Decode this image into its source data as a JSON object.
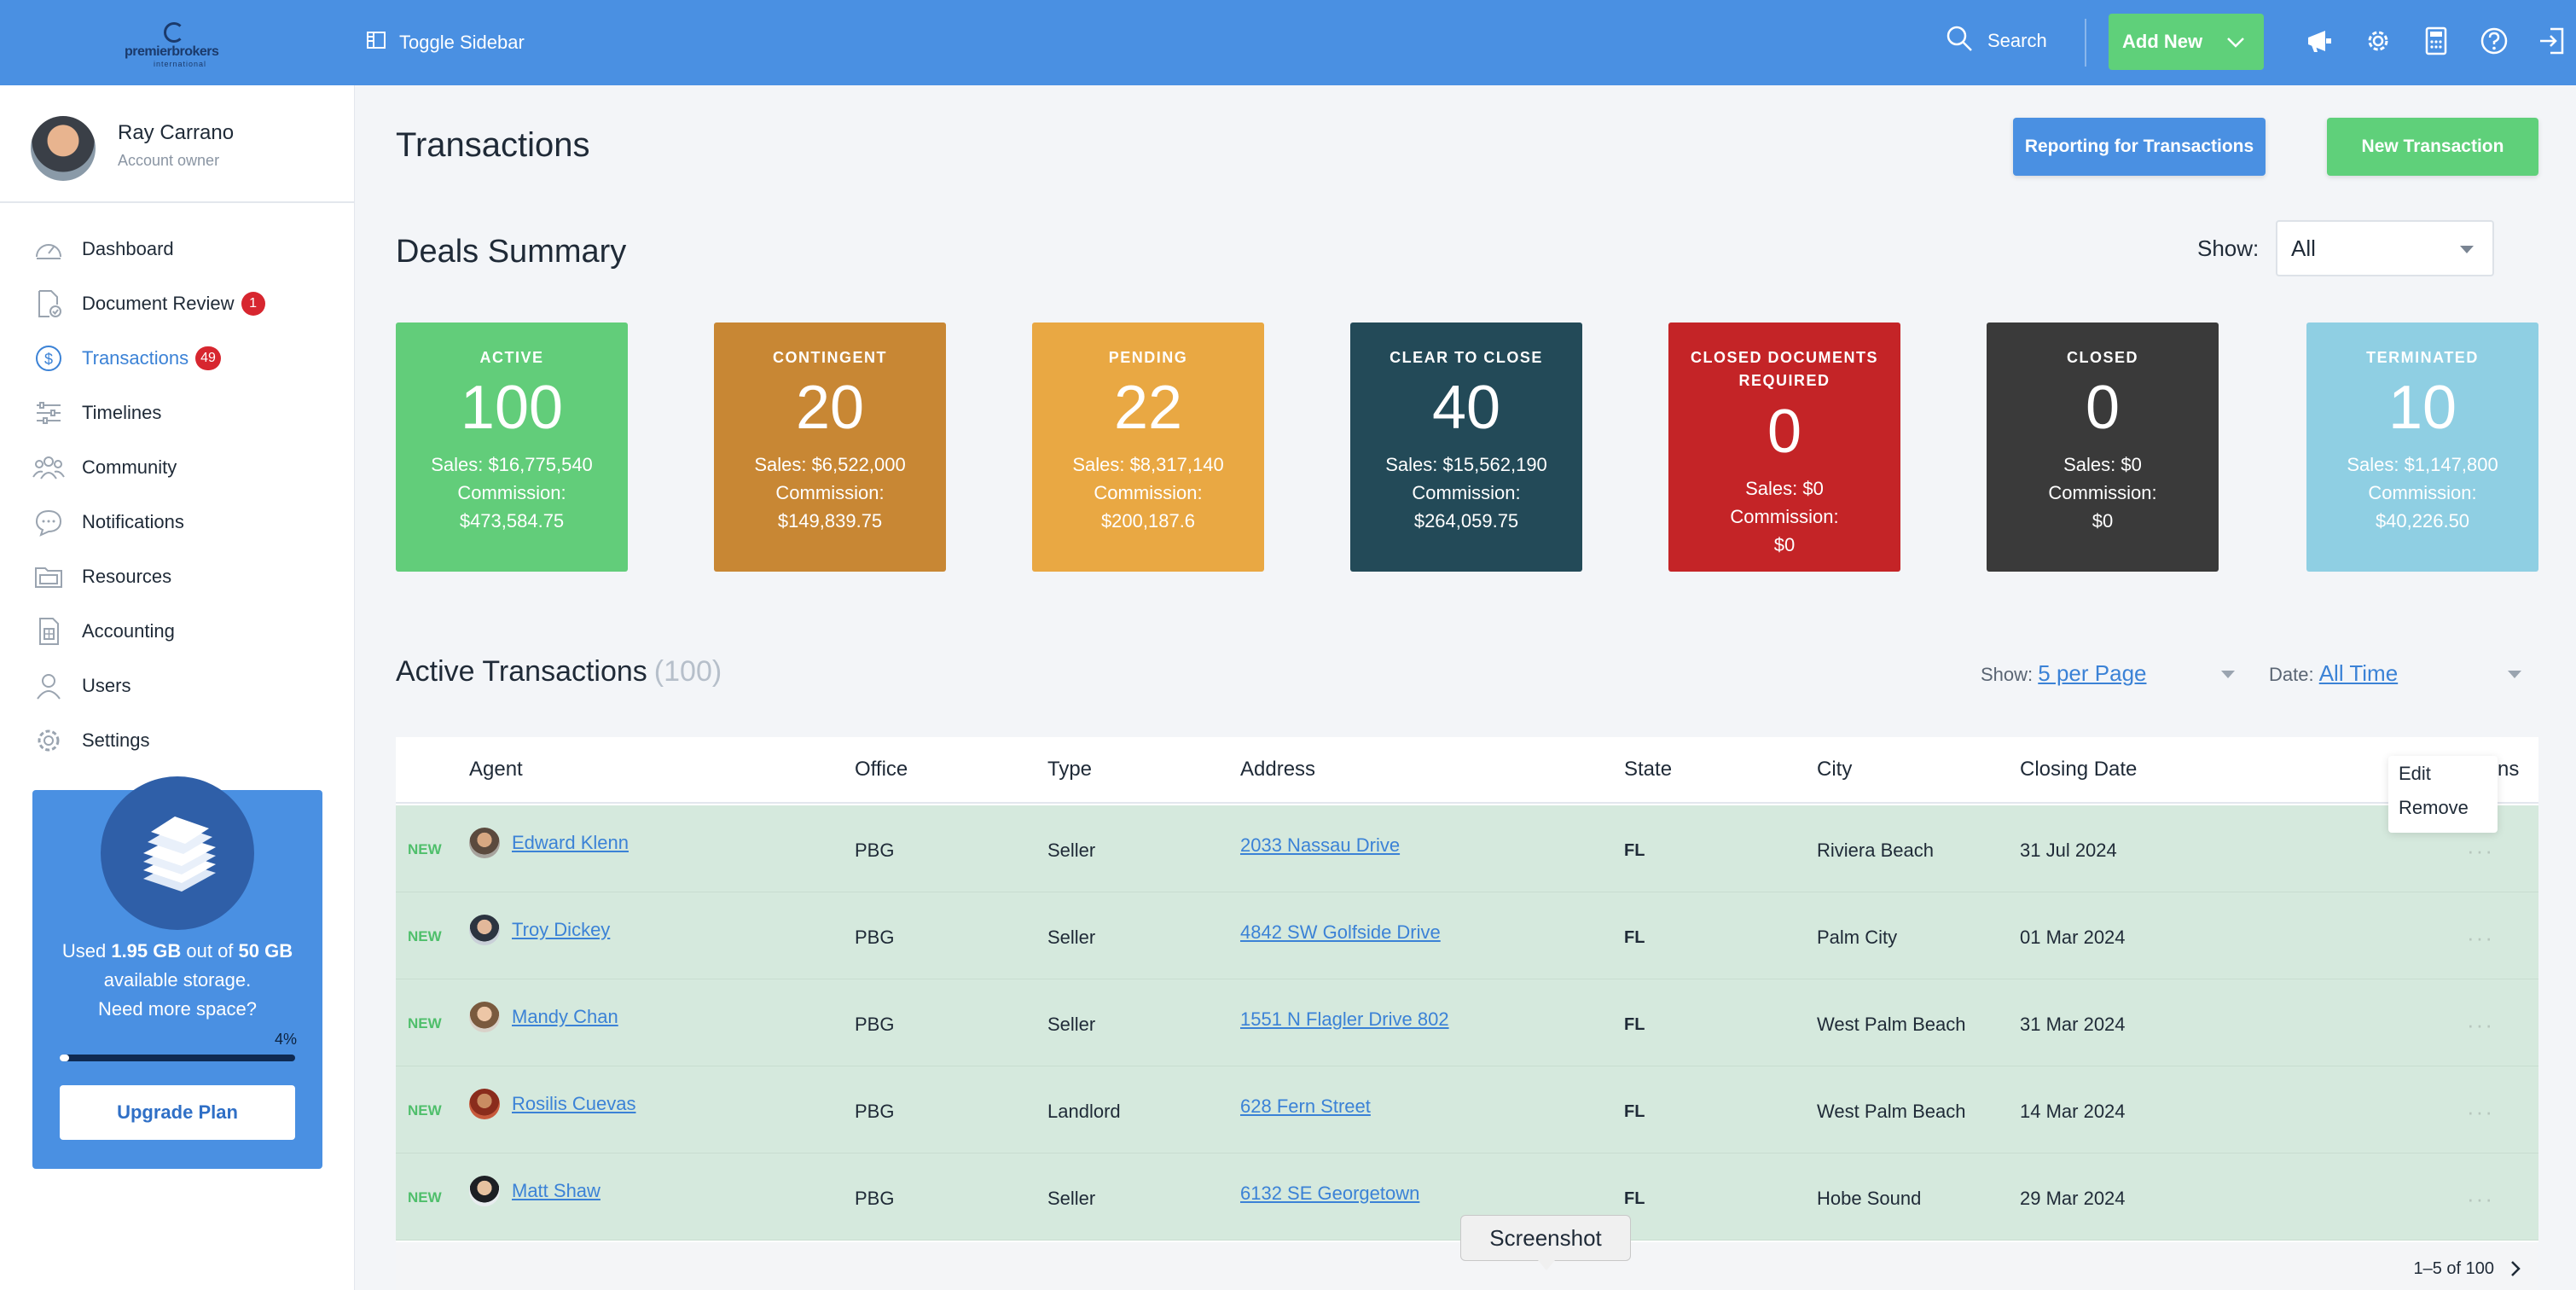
{
  "colors": {
    "topbar": "#4a90e2",
    "active": "#62cd7a",
    "contingent": "#c88734",
    "pending": "#e9a843",
    "clear_to_close": "#234a58",
    "closed_docs": "#c42427",
    "closed": "#3a3a3a",
    "terminated": "#8fcfe3",
    "new_row_bg": "#d5e9dd",
    "link": "#3b82d6"
  },
  "topbar": {
    "logo_text": "premierbrokers",
    "logo_sub": "international",
    "toggle_label": "Toggle Sidebar",
    "search_label": "Search",
    "add_new_label": "Add New",
    "icons": [
      "megaphone-icon",
      "gear-icon",
      "calculator-icon",
      "help-icon",
      "logout-icon"
    ]
  },
  "profile": {
    "name": "Ray Carrano",
    "role": "Account owner"
  },
  "sidebar": {
    "items": [
      {
        "label": "Dashboard",
        "icon": "dashboard-icon",
        "badge": ""
      },
      {
        "label": "Document Review",
        "icon": "document-check-icon",
        "badge": "1"
      },
      {
        "label": "Transactions",
        "icon": "dollar-icon",
        "badge": "49"
      },
      {
        "label": "Timelines",
        "icon": "sliders-icon",
        "badge": ""
      },
      {
        "label": "Community",
        "icon": "people-icon",
        "badge": ""
      },
      {
        "label": "Notifications",
        "icon": "chat-icon",
        "badge": ""
      },
      {
        "label": "Resources",
        "icon": "folder-icon",
        "badge": ""
      },
      {
        "label": "Accounting",
        "icon": "calculator-icon",
        "badge": ""
      },
      {
        "label": "Users",
        "icon": "user-icon",
        "badge": ""
      },
      {
        "label": "Settings",
        "icon": "gear-icon",
        "badge": ""
      }
    ]
  },
  "storage": {
    "used_prefix": "Used ",
    "used": "1.95 GB",
    "mid": " out of ",
    "total": "50 GB",
    "suffix": " available storage.",
    "more": "Need more space?",
    "percent_label": "4%",
    "percent": 4,
    "upgrade_label": "Upgrade Plan"
  },
  "page": {
    "title": "Transactions",
    "reporting_label": "Reporting for Transactions",
    "new_transaction_label": "New Transaction"
  },
  "deals": {
    "title": "Deals Summary",
    "show_label": "Show:",
    "show_value": "All",
    "cards": [
      {
        "label": "ACTIVE",
        "count": "100",
        "sales": "Sales: $16,775,540",
        "commission_label": "Commission:",
        "commission": "$473,584.75"
      },
      {
        "label": "CONTINGENT",
        "count": "20",
        "sales": "Sales: $6,522,000",
        "commission_label": "Commission:",
        "commission": "$149,839.75"
      },
      {
        "label": "PENDING",
        "count": "22",
        "sales": "Sales: $8,317,140",
        "commission_label": "Commission:",
        "commission": "$200,187.6"
      },
      {
        "label": "CLEAR TO CLOSE",
        "count": "40",
        "sales": "Sales: $15,562,190",
        "commission_label": "Commission:",
        "commission": "$264,059.75"
      },
      {
        "label": "CLOSED DOCUMENTS REQUIRED",
        "count": "0",
        "sales": "Sales: $0",
        "commission_label": "Commission:",
        "commission": "$0"
      },
      {
        "label": "CLOSED",
        "count": "0",
        "sales": "Sales: $0",
        "commission_label": "Commission:",
        "commission": "$0"
      },
      {
        "label": "TERMINATED",
        "count": "10",
        "sales": "Sales: $1,147,800",
        "commission_label": "Commission:",
        "commission": "$40,226.50"
      }
    ]
  },
  "active_transactions": {
    "title": "Active Transactions",
    "count": "(100)",
    "show_label": "Show:",
    "show_value": "5 per Page",
    "date_label": "Date:",
    "date_value": "All Time",
    "columns": [
      "Agent",
      "Office",
      "Type",
      "Address",
      "State",
      "City",
      "Closing Date",
      "Actions"
    ],
    "actions_visible": "ns",
    "menu": {
      "edit": "Edit",
      "remove": "Remove"
    },
    "rows": [
      {
        "status": "NEW",
        "agent": "Edward Klenn",
        "office": "PBG",
        "type": "Seller",
        "address": "2033 Nassau Drive",
        "state": "FL",
        "city": "Riviera Beach",
        "closing": "31 Jul 2024"
      },
      {
        "status": "NEW",
        "agent": "Troy Dickey",
        "office": "PBG",
        "type": "Seller",
        "address": "4842 SW Golfside Drive",
        "state": "FL",
        "city": "Palm City",
        "closing": "01 Mar 2024"
      },
      {
        "status": "NEW",
        "agent": "Mandy Chan",
        "office": "PBG",
        "type": "Seller",
        "address": "1551 N Flagler Drive 802",
        "state": "FL",
        "city": "West Palm Beach",
        "closing": "31 Mar 2024"
      },
      {
        "status": "NEW",
        "agent": "Rosilis Cuevas",
        "office": "PBG",
        "type": "Landlord",
        "address": "628 Fern Street",
        "state": "FL",
        "city": "West Palm Beach",
        "closing": "14 Mar 2024"
      },
      {
        "status": "NEW",
        "agent": "Matt Shaw",
        "office": "PBG",
        "type": "Seller",
        "address": "6132 SE Georgetown",
        "state": "FL",
        "city": "Hobe Sound",
        "closing": "29 Mar 2024"
      }
    ],
    "pagination": "1–5 of 100"
  },
  "tooltip": "Screenshot"
}
